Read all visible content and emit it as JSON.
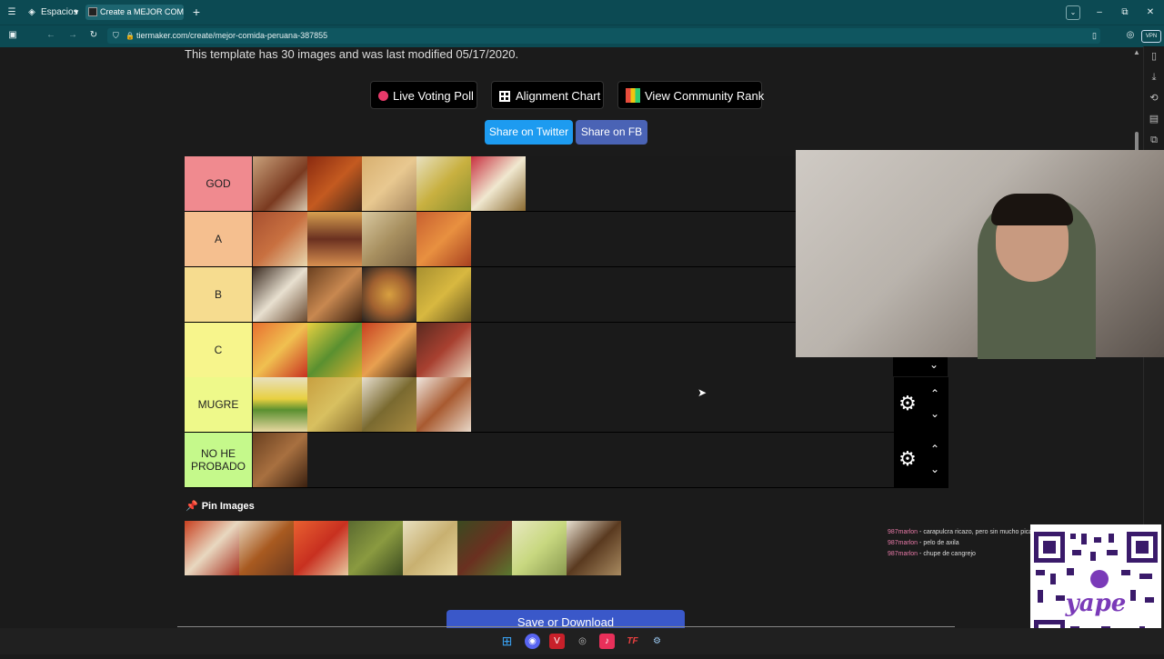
{
  "browser": {
    "workspaces_label": "Espacios",
    "tab_title": "Create a MEJOR COMIDA P",
    "url": "tiermaker.com/create/mejor-comida-peruana-387855"
  },
  "page": {
    "template_info": "This template has 30 images and was last modified 05/17/2020.",
    "buttons": {
      "live_voting": "Live Voting Poll",
      "alignment": "Alignment Chart",
      "community_rank": "View Community Rank",
      "share_twitter": "Share on Twitter",
      "share_fb": "Share on FB",
      "save": "Save or Download"
    },
    "tiers": [
      {
        "label": "GOD",
        "color": "#f08a8f",
        "images": 5
      },
      {
        "label": "A",
        "color": "#f5bf8f",
        "images": 4
      },
      {
        "label": "B",
        "color": "#f6dc8f",
        "images": 4
      },
      {
        "label": "C",
        "color": "#f7f58c",
        "images": 4
      },
      {
        "label": "MUGRE",
        "color": "#eef98a",
        "images": 4
      },
      {
        "label": "NO HE PROBADO",
        "color": "#c5f98b",
        "images": 1
      }
    ],
    "pin_images_label": "Pin Images",
    "pin_images_count": 8
  },
  "chat": [
    {
      "user": "987marlon",
      "message": "carapulcra ricazo, pero sin mucho pica"
    },
    {
      "user": "987marlon",
      "message": "pelo de axila"
    },
    {
      "user": "987marlon",
      "message": "chupe de cangrejo"
    }
  ],
  "qr_brand": "yape",
  "colors": {
    "browser_chrome": "#0c4a53",
    "twitter_blue": "#1d9bf0",
    "fb_blue": "#4a63b5",
    "save_blue": "#3a58c9"
  }
}
